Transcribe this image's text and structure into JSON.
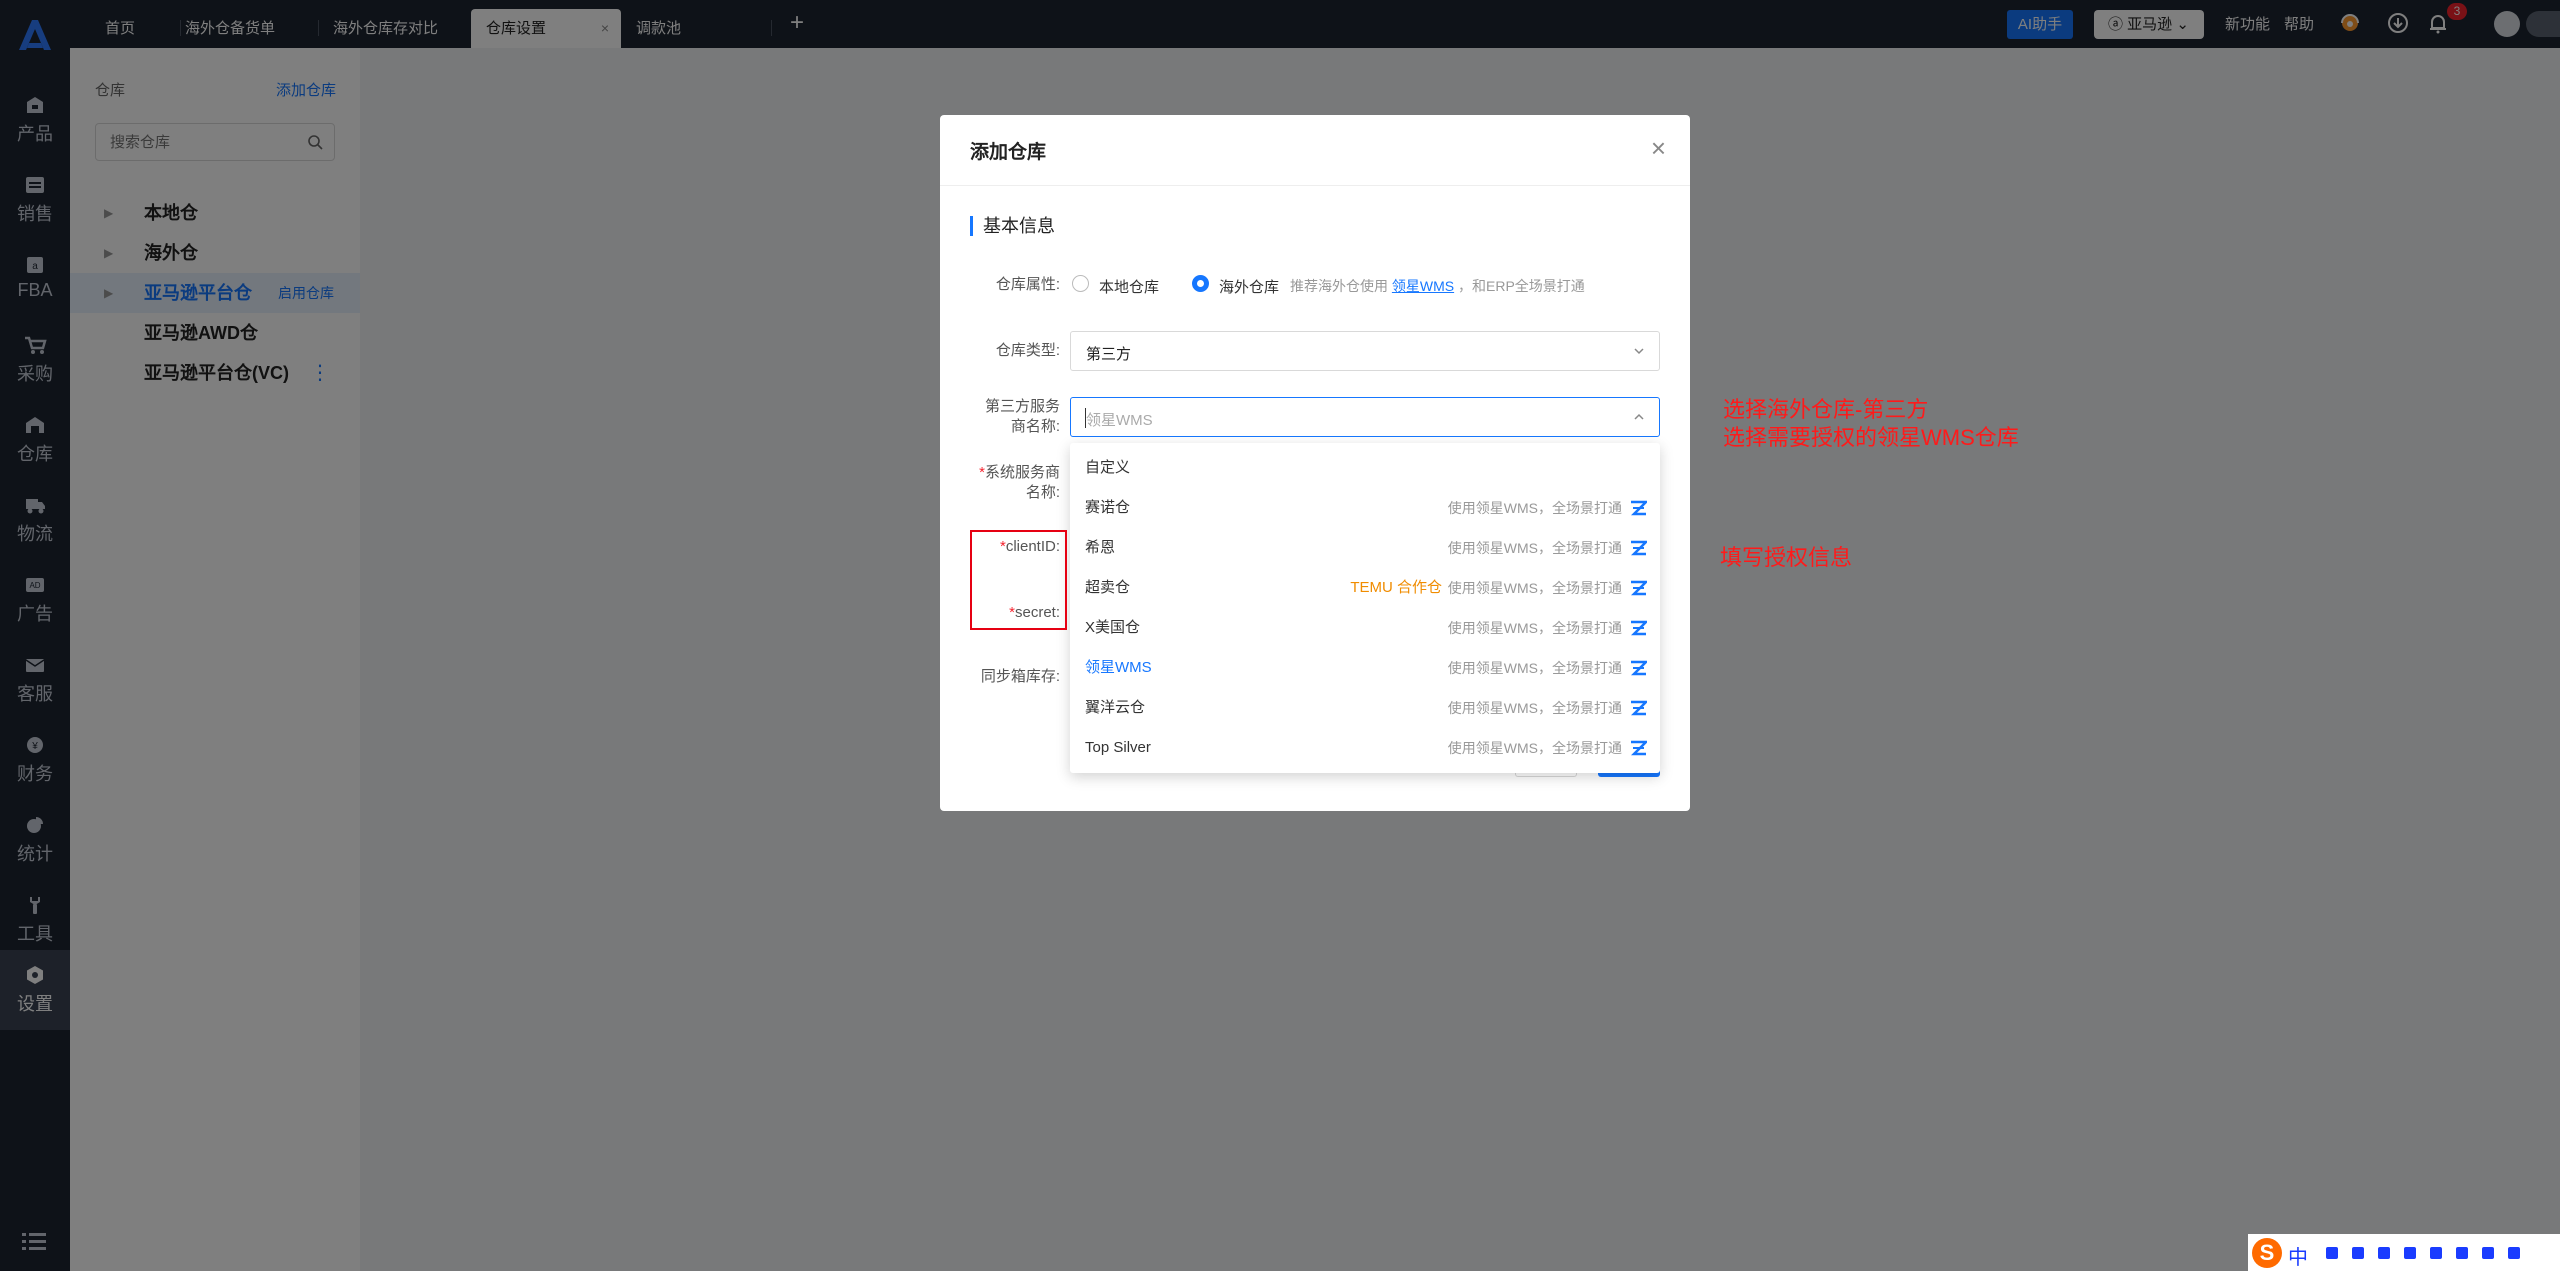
{
  "rail": {
    "items": [
      {
        "label": "产品",
        "icon": "product-icon"
      },
      {
        "label": "销售",
        "icon": "sales-icon"
      },
      {
        "label": "FBA",
        "icon": "fba-icon"
      },
      {
        "label": "采购",
        "icon": "cart-icon"
      },
      {
        "label": "仓库",
        "icon": "warehouse-icon"
      },
      {
        "label": "物流",
        "icon": "truck-icon"
      },
      {
        "label": "广告",
        "icon": "ad-icon"
      },
      {
        "label": "客服",
        "icon": "mail-icon"
      },
      {
        "label": "财务",
        "icon": "finance-icon"
      },
      {
        "label": "统计",
        "icon": "pie-icon"
      },
      {
        "label": "工具",
        "icon": "wrench-icon"
      },
      {
        "label": "设置",
        "icon": "settings-icon"
      }
    ]
  },
  "tabs": [
    {
      "label": "首页"
    },
    {
      "label": "海外仓备货单"
    },
    {
      "label": "海外仓库存对比"
    },
    {
      "label": "仓库设置",
      "close": "×"
    },
    {
      "label": "调款池"
    }
  ],
  "topbar": {
    "ai": "AI助手",
    "store": "亚马逊",
    "new_feature": "新功能",
    "help": "帮助",
    "badge": "3"
  },
  "panel": {
    "title": "仓库",
    "add": "添加仓库",
    "search_placeholder": "搜索仓库",
    "tree": [
      {
        "label": "本地仓"
      },
      {
        "label": "海外仓"
      },
      {
        "label": "亚马逊平台仓",
        "action": "启用仓库"
      },
      {
        "label": "亚马逊AWD仓"
      },
      {
        "label": "亚马逊平台仓(VC)",
        "more": "⋮"
      }
    ]
  },
  "modal": {
    "title": "添加仓库",
    "close": "×",
    "section": "基本信息",
    "attr_label": "仓库属性:",
    "radio_local": "本地仓库",
    "radio_overseas": "海外仓库",
    "hint_pre": "推荐海外仓使用",
    "hint_link": "领星WMS",
    "hint_post": "，和ERP全场景打通",
    "type_label": "仓库类型:",
    "type_value": "第三方",
    "provider_label_1": "第三方服务",
    "provider_label_2": "商名称:",
    "provider_value": "领星WMS",
    "sys_label_1": "系统服务商",
    "sys_label_2": "名称:",
    "client_label": "clientID:",
    "secret_label": "secret:",
    "sync_label": "同步箱库存:",
    "required_mark": "*"
  },
  "dropdown": {
    "options": [
      {
        "name": "自定义",
        "note": "",
        "tag": ""
      },
      {
        "name": "赛诺仓",
        "note": "使用领星WMS，全场景打通",
        "tag": ""
      },
      {
        "name": "希恩",
        "note": "使用领星WMS，全场景打通",
        "tag": ""
      },
      {
        "name": "超卖仓",
        "note": "使用领星WMS，全场景打通",
        "tag": "TEMU 合作仓"
      },
      {
        "name": "X美国仓",
        "note": "使用领星WMS，全场景打通",
        "tag": ""
      },
      {
        "name": "领星WMS",
        "note": "使用领星WMS，全场景打通",
        "tag": "",
        "selected": true
      },
      {
        "name": "翼洋云仓",
        "note": "使用领星WMS，全场景打通",
        "tag": ""
      },
      {
        "name": "Top Silver",
        "note": "使用领星WMS，全场景打通",
        "tag": ""
      }
    ]
  },
  "annotations": {
    "line1": "选择海外仓库-第三方",
    "line2": "选择需要授权的领星WMS仓库",
    "line3": "填写授权信息"
  },
  "ime": {
    "lang": "中"
  },
  "colors": {
    "accent": "#1677ff",
    "rail_bg": "#1c2430",
    "annotation": "#ff1a1a",
    "tag_orange": "#f08c00"
  }
}
